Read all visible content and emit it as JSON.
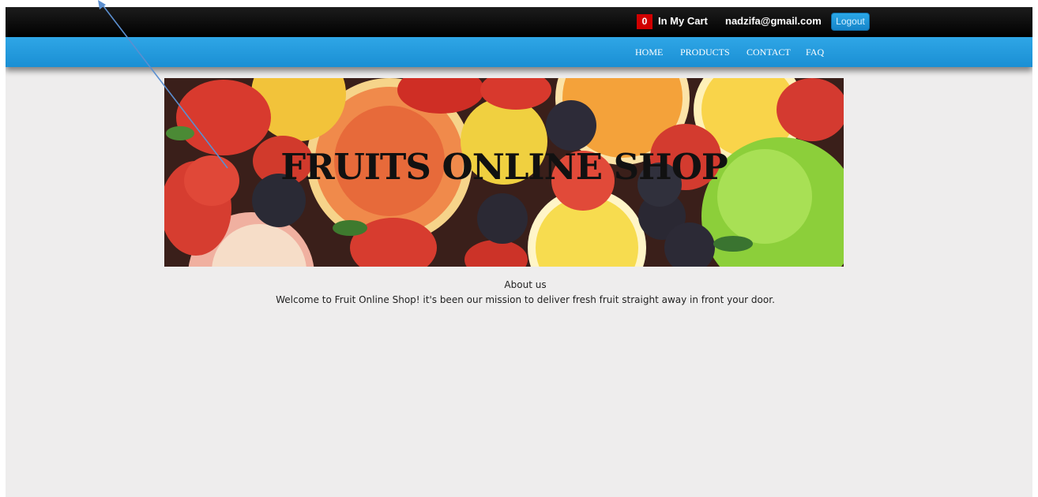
{
  "header": {
    "cart_count": "0",
    "cart_label": "In My Cart",
    "user_email": "nadzifa@gmail.com",
    "logout_label": "Logout"
  },
  "nav": {
    "items": [
      {
        "label": "HOME"
      },
      {
        "label": "PRODUCTS"
      },
      {
        "label": "CONTACT"
      },
      {
        "label": "FAQ"
      }
    ]
  },
  "banner": {
    "title": "FRUITS ONLINE SHOP"
  },
  "about": {
    "title": "About us",
    "text": "Welcome to Fruit Online Shop! it's been our mission to deliver fresh fruit straight away in front your door."
  },
  "colors": {
    "topbar": "#000000",
    "navbar": "#2aa1e2",
    "cart_badge": "#d00000",
    "page_background": "#eeeded"
  }
}
